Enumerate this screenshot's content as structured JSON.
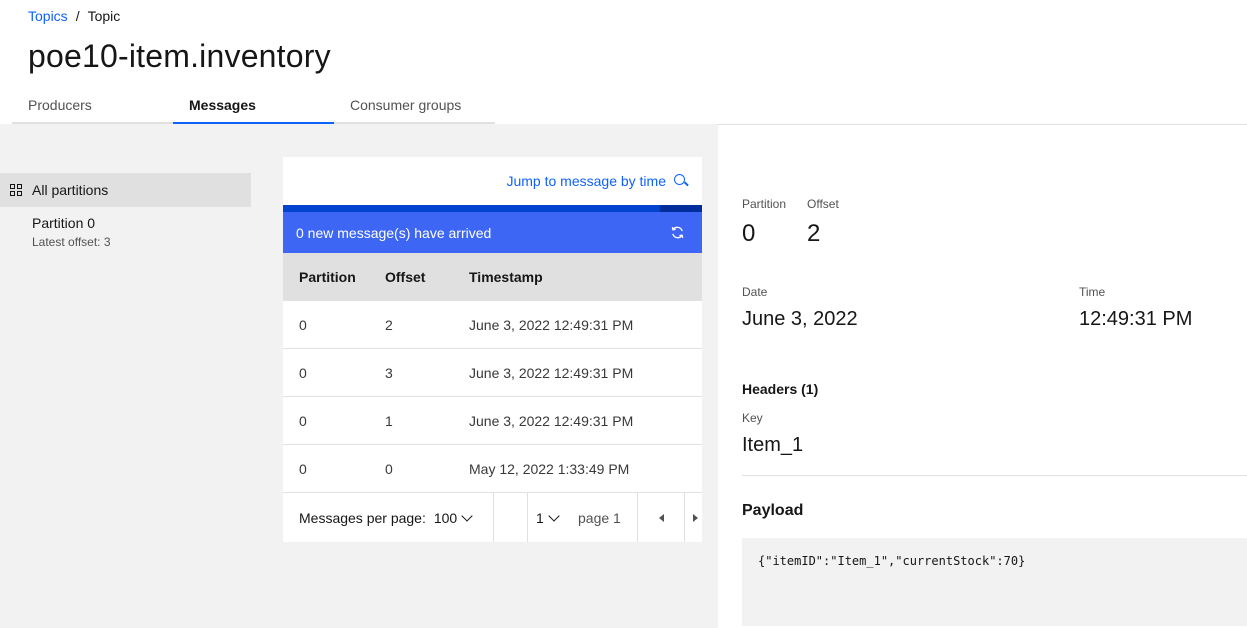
{
  "breadcrumb": {
    "link": "Topics",
    "separator": "/",
    "current": "Topic"
  },
  "page_title": "poe10-item.inventory",
  "tabs": [
    {
      "label": "Producers",
      "active": false
    },
    {
      "label": "Messages",
      "active": true
    },
    {
      "label": "Consumer groups",
      "active": false
    }
  ],
  "partitions": {
    "all_label": "All partitions",
    "items": [
      {
        "name": "Partition 0",
        "latest_offset": "Latest offset: 3"
      }
    ]
  },
  "messages": {
    "jump_label": "Jump to message by time",
    "banner": "0 new message(s) have arrived",
    "columns": [
      "Partition",
      "Offset",
      "Timestamp"
    ],
    "rows": [
      {
        "partition": "0",
        "offset": "2",
        "timestamp": "June 3, 2022 12:49:31 PM"
      },
      {
        "partition": "0",
        "offset": "3",
        "timestamp": "June 3, 2022 12:49:31 PM"
      },
      {
        "partition": "0",
        "offset": "1",
        "timestamp": "June 3, 2022 12:49:31 PM"
      },
      {
        "partition": "0",
        "offset": "0",
        "timestamp": "May 12, 2022 1:33:49 PM"
      }
    ],
    "pagination": {
      "per_page_label": "Messages per page:",
      "per_page_value": "100",
      "page_value": "1",
      "page_label": "page 1"
    }
  },
  "detail": {
    "partition_label": "Partition",
    "partition_value": "0",
    "offset_label": "Offset",
    "offset_value": "2",
    "date_label": "Date",
    "date_value": "June 3, 2022",
    "time_label": "Time",
    "time_value": "12:49:31 PM",
    "headers_label": "Headers (1)",
    "key_label": "Key",
    "key_value": "Item_1",
    "payload_label": "Payload",
    "payload_value": "{\"itemID\":\"Item_1\",\"currentStock\":70}"
  },
  "colors": {
    "accent": "#0f62fe",
    "banner": "#3d66f5",
    "gray_bg": "#f2f2f2"
  }
}
